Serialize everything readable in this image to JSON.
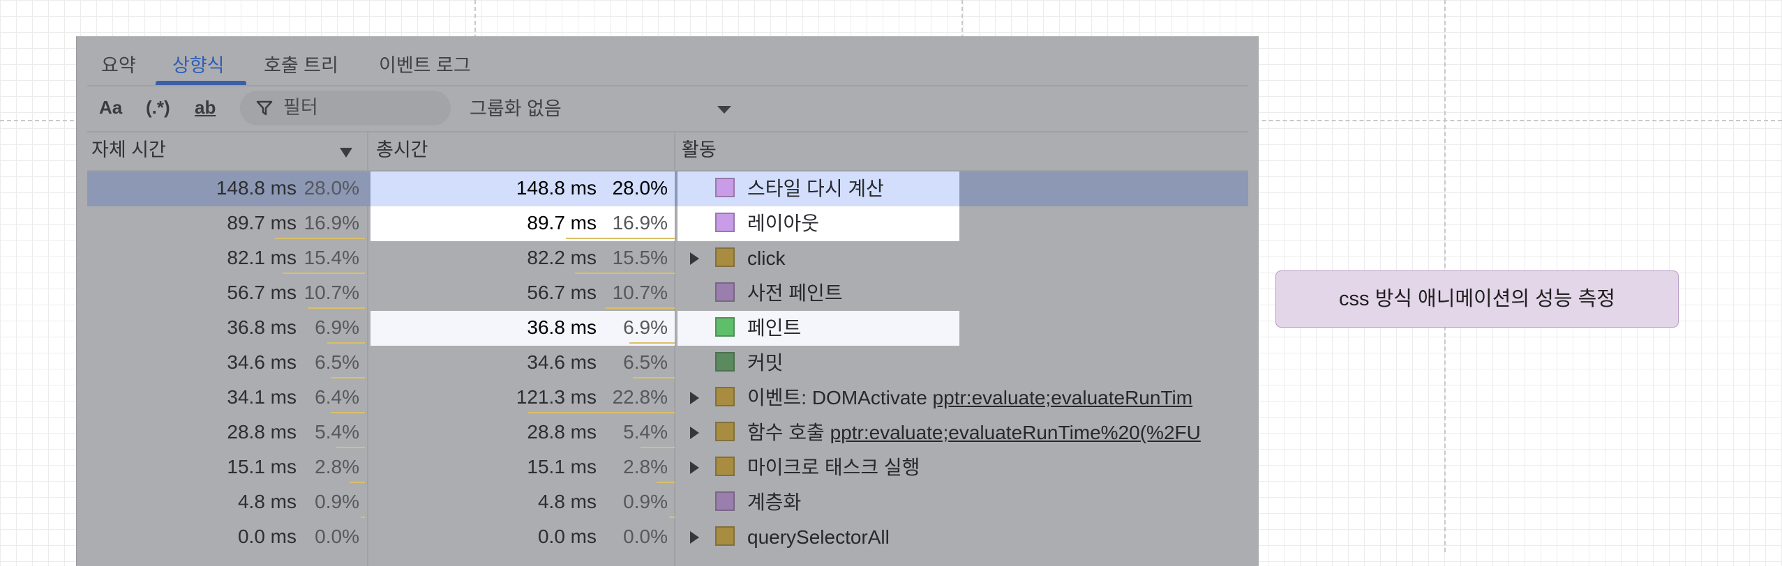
{
  "tabs": [
    "요약",
    "상향식",
    "호출 트리",
    "이벤트 로그"
  ],
  "active_tab": "상향식",
  "toolbar": {
    "match_case": "Aa",
    "regex": "(.*)",
    "whole_word": "ab",
    "filter_placeholder": "필터",
    "grouping": "그룹화 없음"
  },
  "columns": {
    "self_time": "자체 시간",
    "total_time": "총시간",
    "activity": "활동"
  },
  "rows": [
    {
      "self_ms": "148.8 ms",
      "self_pct": "28.0%",
      "total_ms": "148.8 ms",
      "total_pct": "28.0%",
      "name": "스타일 다시 계산",
      "link": "",
      "expandable": false,
      "color": "#c89ce6",
      "self_frac": 1.0,
      "total_frac": 1.0
    },
    {
      "self_ms": "89.7 ms",
      "self_pct": "16.9%",
      "total_ms": "89.7 ms",
      "total_pct": "16.9%",
      "name": "레이아웃",
      "link": "",
      "expandable": false,
      "color": "#c89ce6",
      "self_frac": 0.6,
      "total_frac": 0.6
    },
    {
      "self_ms": "82.1 ms",
      "self_pct": "15.4%",
      "total_ms": "82.2 ms",
      "total_pct": "15.5%",
      "name": "click",
      "link": "",
      "expandable": true,
      "color": "#a88c3f",
      "self_frac": 0.55,
      "total_frac": 0.55
    },
    {
      "self_ms": "56.7 ms",
      "self_pct": "10.7%",
      "total_ms": "56.7 ms",
      "total_pct": "10.7%",
      "name": "사전 페인트",
      "link": "",
      "expandable": false,
      "color": "#9a7eae",
      "self_frac": 0.38,
      "total_frac": 0.38
    },
    {
      "self_ms": "36.8 ms",
      "self_pct": "6.9%",
      "total_ms": "36.8 ms",
      "total_pct": "6.9%",
      "name": "페인트",
      "link": "",
      "expandable": false,
      "color": "#5fbe6a",
      "self_frac": 0.25,
      "total_frac": 0.25
    },
    {
      "self_ms": "34.6 ms",
      "self_pct": "6.5%",
      "total_ms": "34.6 ms",
      "total_pct": "6.5%",
      "name": "커밋",
      "link": "",
      "expandable": false,
      "color": "#5a8a5e",
      "self_frac": 0.23,
      "total_frac": 0.23
    },
    {
      "self_ms": "34.1 ms",
      "self_pct": "6.4%",
      "total_ms": "121.3 ms",
      "total_pct": "22.8%",
      "name": "이벤트: DOMActivate",
      "link": "pptr:evaluate;evaluateRunTim",
      "expandable": true,
      "color": "#a88c3f",
      "self_frac": 0.23,
      "total_frac": 0.81
    },
    {
      "self_ms": "28.8 ms",
      "self_pct": "5.4%",
      "total_ms": "28.8 ms",
      "total_pct": "5.4%",
      "name": "함수 호출",
      "link": "pptr:evaluate;evaluateRunTime%20(%2FU",
      "expandable": true,
      "color": "#a88c3f",
      "self_frac": 0.19,
      "total_frac": 0.19
    },
    {
      "self_ms": "15.1 ms",
      "self_pct": "2.8%",
      "total_ms": "15.1 ms",
      "total_pct": "2.8%",
      "name": "마이크로 태스크 실행",
      "link": "",
      "expandable": true,
      "color": "#a88c3f",
      "self_frac": 0.1,
      "total_frac": 0.1
    },
    {
      "self_ms": "4.8 ms",
      "self_pct": "0.9%",
      "total_ms": "4.8 ms",
      "total_pct": "0.9%",
      "name": "계층화",
      "link": "",
      "expandable": false,
      "color": "#9a7eae",
      "self_frac": 0.03,
      "total_frac": 0.03
    },
    {
      "self_ms": "0.0 ms",
      "self_pct": "0.0%",
      "total_ms": "0.0 ms",
      "total_pct": "0.0%",
      "name": "querySelectorAll",
      "link": "",
      "expandable": true,
      "color": "#a88c3f",
      "self_frac": 0.0,
      "total_frac": 0.0
    }
  ],
  "tooltip": "css 방식 애니메이션의 성능 측정",
  "colors": {
    "overlay_panel": "#acadb0",
    "selected_row": "#8c98b4",
    "active_tab": "#2e5fb8",
    "highlight_selected": "#d2defc",
    "highlight_white": "#ffffff",
    "highlight_light": "#f4f6fb",
    "percent_bar": "#d9c06a",
    "tooltip_bg": "#e3d6e8"
  }
}
